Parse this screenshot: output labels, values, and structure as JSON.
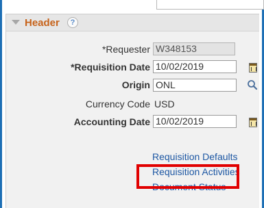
{
  "header": {
    "title": "Header",
    "help_symbol": "?",
    "expand_icon": "triangle-down-icon"
  },
  "fields": {
    "requester": {
      "label": "*Requester",
      "value": "W348153"
    },
    "requisition_date": {
      "label": "*Requisition Date",
      "value": "10/02/2019"
    },
    "origin": {
      "label": "Origin",
      "value": "ONL"
    },
    "currency_code": {
      "label": "Currency Code",
      "value": "USD"
    },
    "accounting_date": {
      "label": "Accounting Date",
      "value": "10/02/2019"
    }
  },
  "links": {
    "requisition_defaults": "Requisition Defaults",
    "requisition_activities": "Requisition Activities",
    "document_status": "Document Status"
  },
  "colors": {
    "header_title": "#c7631b",
    "link": "#1d57a3",
    "highlight": "#e10000",
    "frame": "#1d6fb5"
  }
}
